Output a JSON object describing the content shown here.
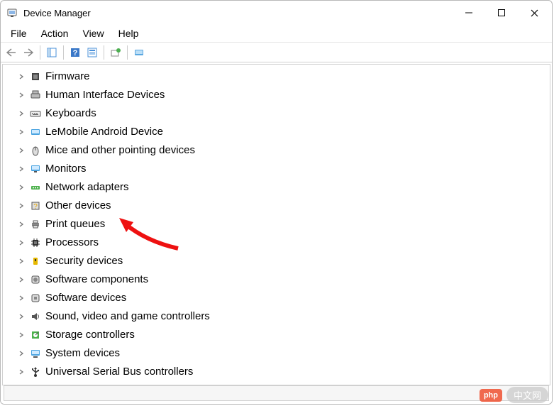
{
  "window": {
    "title": "Device Manager"
  },
  "menu": {
    "file": "File",
    "action": "Action",
    "view": "View",
    "help": "Help"
  },
  "tree": {
    "items": [
      {
        "label": "Firmware",
        "icon": "firmware"
      },
      {
        "label": "Human Interface Devices",
        "icon": "hid"
      },
      {
        "label": "Keyboards",
        "icon": "keyboard"
      },
      {
        "label": "LeMobile Android Device",
        "icon": "android"
      },
      {
        "label": "Mice and other pointing devices",
        "icon": "mouse"
      },
      {
        "label": "Monitors",
        "icon": "monitor"
      },
      {
        "label": "Network adapters",
        "icon": "network"
      },
      {
        "label": "Other devices",
        "icon": "other"
      },
      {
        "label": "Print queues",
        "icon": "printer"
      },
      {
        "label": "Processors",
        "icon": "processor"
      },
      {
        "label": "Security devices",
        "icon": "security"
      },
      {
        "label": "Software components",
        "icon": "softcomp"
      },
      {
        "label": "Software devices",
        "icon": "softdev"
      },
      {
        "label": "Sound, video and game controllers",
        "icon": "sound"
      },
      {
        "label": "Storage controllers",
        "icon": "storage"
      },
      {
        "label": "System devices",
        "icon": "system"
      },
      {
        "label": "Universal Serial Bus controllers",
        "icon": "usb"
      }
    ]
  },
  "watermark": {
    "badge": "php",
    "text": "中文网"
  }
}
